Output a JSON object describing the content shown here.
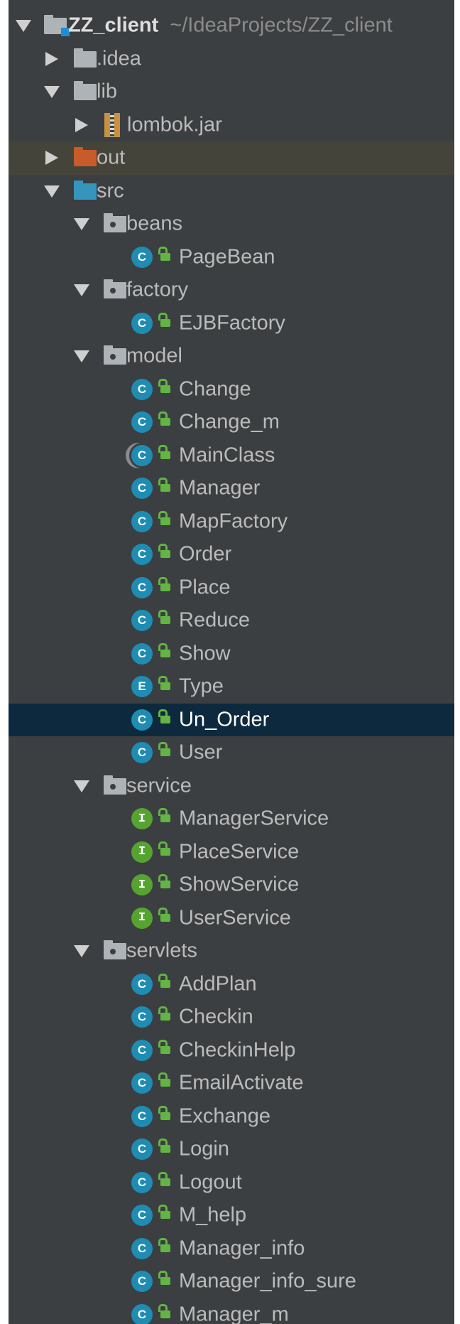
{
  "project": {
    "name": "ZZ_client",
    "path": "~/IdeaProjects/ZZ_client"
  },
  "top_folders": [
    {
      "label": ".idea",
      "expanded": false
    },
    {
      "label": "lib",
      "expanded": true
    },
    {
      "label": "out",
      "expanded": false
    },
    {
      "label": "src",
      "expanded": true
    }
  ],
  "lib_items": [
    "lombok.jar"
  ],
  "packages": {
    "beans": {
      "label": "beans",
      "items": [
        "PageBean"
      ]
    },
    "factory": {
      "label": "factory",
      "items": [
        "EJBFactory"
      ]
    },
    "model": {
      "label": "model",
      "items": [
        "Change",
        "Change_m",
        "MainClass",
        "Manager",
        "MapFactory",
        "Order",
        "Place",
        "Reduce",
        "Show",
        "Type",
        "Un_Order",
        "User"
      ]
    },
    "service": {
      "label": "service",
      "items": [
        "ManagerService",
        "PlaceService",
        "ShowService",
        "UserService"
      ]
    },
    "servlets": {
      "label": "servlets",
      "items": [
        "AddPlan",
        "Checkin",
        "CheckinHelp",
        "EmailActivate",
        "Exchange",
        "Login",
        "Logout",
        "M_help",
        "Manager_info",
        "Manager_info_sure",
        "Manager_m"
      ]
    }
  },
  "badges": {
    "class": "C",
    "interface": "I",
    "enum": "E"
  },
  "selected_item": "Un_Order",
  "colors": {
    "panel_bg": "#3c3f41",
    "selection_bg": "#0d293e",
    "out_highlight_bg": "#45443b",
    "class_badge": "#1e8cb3",
    "interface_badge": "#56a331",
    "out_folder": "#c75b2a",
    "src_folder": "#3595bd"
  }
}
